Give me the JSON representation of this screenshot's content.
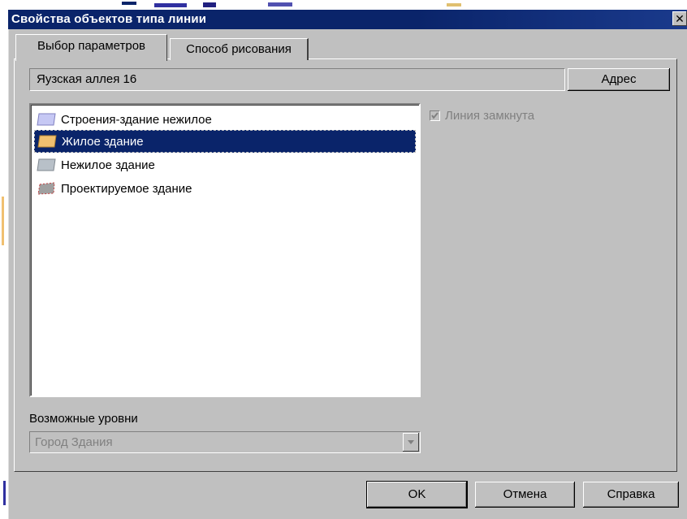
{
  "window": {
    "title": "Свойства объектов типа линии"
  },
  "tabs": [
    {
      "label": "Выбор параметров",
      "active": true
    },
    {
      "label": "Способ рисования",
      "active": false
    }
  ],
  "address": {
    "value": "Яузская аллея 16",
    "button_label": "Адрес"
  },
  "object_list": {
    "items": [
      {
        "label": "Строения-здание нежилое",
        "swatch_color": "#c6c8f4",
        "selected": false
      },
      {
        "label": "Жилое здание",
        "swatch_color": "#f0c070",
        "selected": true
      },
      {
        "label": "Нежилое здание",
        "swatch_color": "#b8c0c8",
        "selected": false
      },
      {
        "label": "Проектируемое здание",
        "swatch_color": "#a0a0a0",
        "selected": false
      }
    ]
  },
  "closed_line_checkbox": {
    "label": "Линия замкнута",
    "checked": true,
    "disabled": true
  },
  "levels": {
    "label": "Возможные уровни",
    "selected_value": "Город Здания",
    "disabled": true
  },
  "buttons": {
    "ok": "OK",
    "cancel": "Отмена",
    "help": "Справка"
  },
  "colors": {
    "title_bar": "#0a246a",
    "face": "#c0c0c0",
    "selection": "#0a246a"
  }
}
